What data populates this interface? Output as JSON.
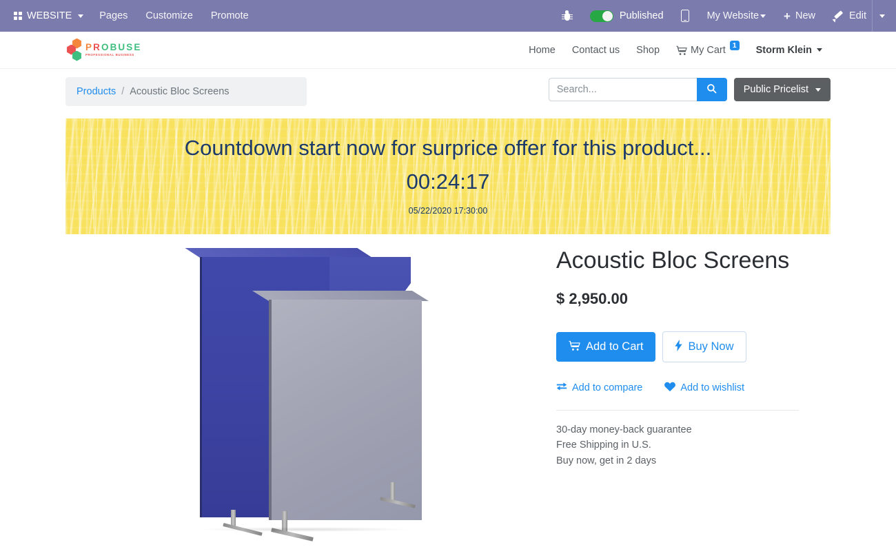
{
  "topbar": {
    "brand": "WEBSITE",
    "brand_icon": "grid-apps-icon",
    "menu": [
      "Pages",
      "Customize",
      "Promote"
    ],
    "debug_icon": "bug-icon",
    "published_label": "Published",
    "published_state": "on",
    "mobile_icon": "mobile-preview-icon",
    "website_selector": "My Website",
    "new_label": "New",
    "new_icon": "plus-icon",
    "edit_label": "Edit",
    "edit_icon": "pencil-icon",
    "accent_color": "#7c7bad",
    "toggle_on_color": "#28a745"
  },
  "site": {
    "logo": {
      "name_part1": "PR",
      "name_part2": "OBUSE",
      "name_full": "PROBUSE",
      "tagline": "PROFESSIONAL BUSINESS"
    },
    "nav": [
      {
        "label": "Home"
      },
      {
        "label": "Contact us"
      },
      {
        "label": "Shop"
      }
    ],
    "cart": {
      "label": "My Cart",
      "count": "1",
      "icon": "shopping-cart-icon"
    },
    "user": {
      "name": "Storm Klein"
    }
  },
  "subbar": {
    "breadcrumb": {
      "parent": "Products",
      "separator": "/",
      "current": "Acoustic Bloc Screens"
    },
    "search": {
      "placeholder": "Search...",
      "value": "",
      "icon": "search-icon"
    },
    "pricelist": {
      "label": "Public Pricelist"
    }
  },
  "countdown": {
    "title": "Countdown start now for surprice offer for this product...",
    "timer": "00:24:17",
    "end_datetime": "05/22/2020 17:30:00",
    "bg_color": "#f8e15d",
    "text_color": "#1b3a6b"
  },
  "product": {
    "name": "Acoustic Bloc Screens",
    "price": "$ 2,950.00",
    "image_alt": "Acoustic Bloc Screens blue and grey panels",
    "add_to_cart": {
      "label": "Add to Cart",
      "icon": "shopping-cart-icon"
    },
    "buy_now": {
      "label": "Buy Now",
      "icon": "lightning-bolt-icon"
    },
    "compare": {
      "label": "Add to compare",
      "icon": "compare-arrows-icon"
    },
    "wishlist": {
      "label": "Add to wishlist",
      "icon": "heart-icon"
    },
    "promos": [
      "30-day money-back guarantee",
      "Free Shipping in U.S.",
      "Buy now, get in 2 days"
    ]
  }
}
